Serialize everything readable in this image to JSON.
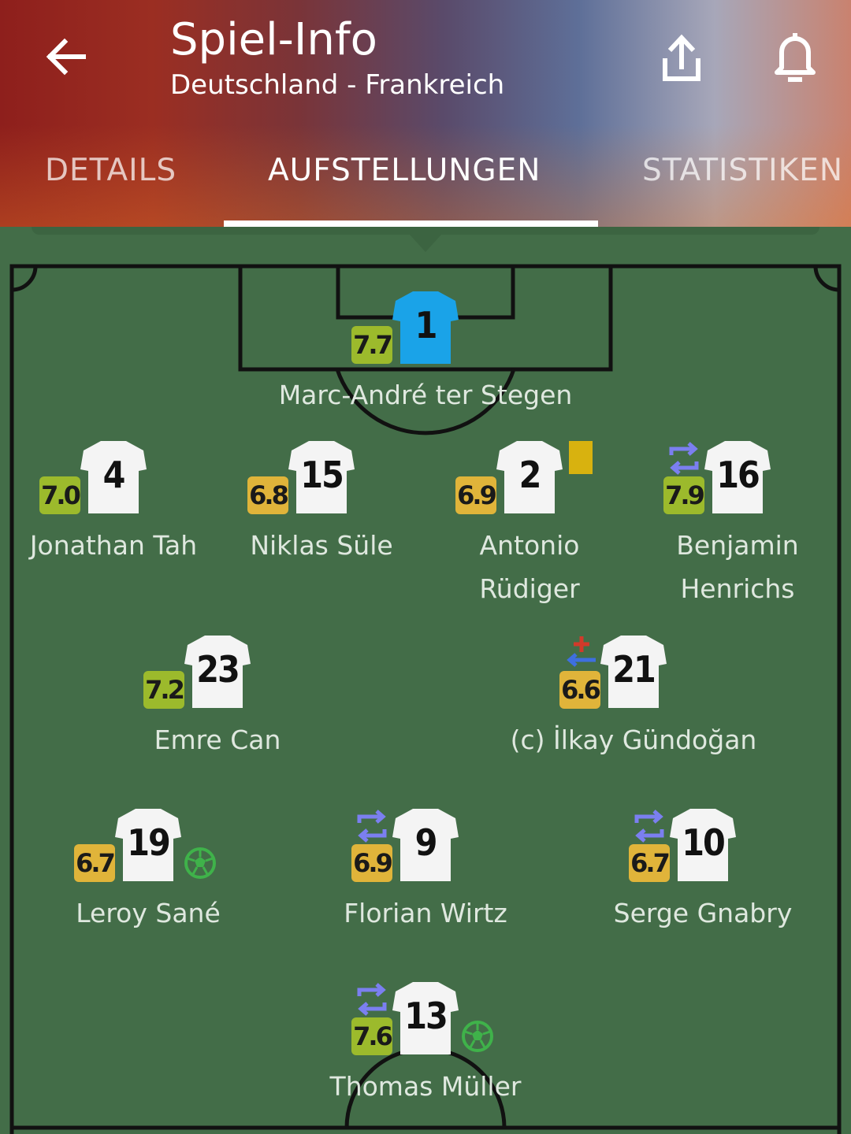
{
  "header": {
    "title": "Spiel-Info",
    "subtitle": "Deutschland - Frankreich",
    "back_icon": "arrow-left-icon",
    "share_icon": "share-icon",
    "bell_icon": "bell-icon"
  },
  "tabs": [
    {
      "label": "DETAILS",
      "active": false
    },
    {
      "label": "AUFSTELLUNGEN",
      "active": true
    },
    {
      "label": "STATISTIKEN",
      "active": false
    }
  ],
  "colors": {
    "pitch": "#436d48",
    "rating_green": "#9cba2c",
    "rating_gold": "#e0b43a",
    "goalkeeper_shirt": "#1aa3e8",
    "yellow_card": "#d8b20f"
  },
  "lineup": [
    {
      "number": "1",
      "name": "Marc-André ter Stegen",
      "rating": "7.7",
      "rating_color": "green",
      "goalkeeper": true
    },
    {
      "number": "4",
      "name": "Jonathan Tah",
      "rating": "7.0",
      "rating_color": "green"
    },
    {
      "number": "15",
      "name": "Niklas Süle",
      "rating": "6.8",
      "rating_color": "gold"
    },
    {
      "number": "2",
      "name": "Antonio Rüdiger",
      "rating": "6.9",
      "rating_color": "gold",
      "yellow_card": true
    },
    {
      "number": "16",
      "name": "Benjamin Henrichs",
      "rating": "7.9",
      "rating_color": "green",
      "substituted": true
    },
    {
      "number": "23",
      "name": "Emre Can",
      "rating": "7.2",
      "rating_color": "green"
    },
    {
      "number": "21",
      "name": "(c) İlkay Gündoğan",
      "rating": "6.6",
      "rating_color": "gold",
      "injury_substitution": true
    },
    {
      "number": "19",
      "name": "Leroy Sané",
      "rating": "6.7",
      "rating_color": "gold",
      "goal": true
    },
    {
      "number": "9",
      "name": "Florian Wirtz",
      "rating": "6.9",
      "rating_color": "gold",
      "substituted": true
    },
    {
      "number": "10",
      "name": "Serge Gnabry",
      "rating": "6.7",
      "rating_color": "gold",
      "substituted": true
    },
    {
      "number": "13",
      "name": "Thomas Müller",
      "rating": "7.6",
      "rating_color": "green",
      "substituted": true,
      "goal": true
    }
  ]
}
